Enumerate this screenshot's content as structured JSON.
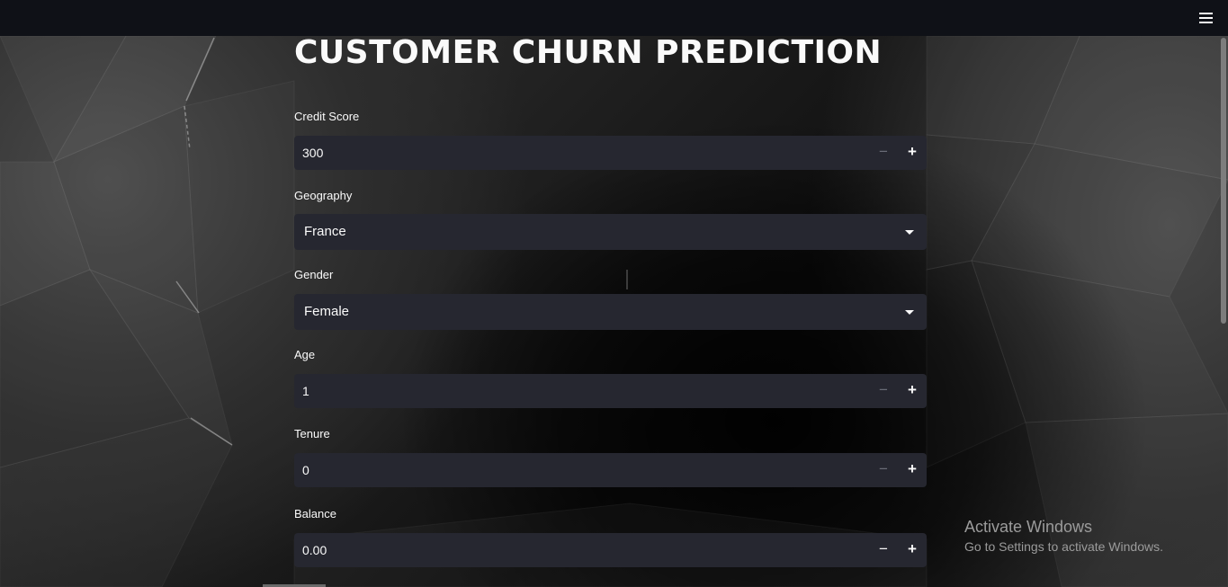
{
  "app": {
    "title": "CUSTOMER CHURN PREDICTION",
    "menu_icon": "hamburger-menu-icon"
  },
  "fields": {
    "credit_score": {
      "label": "Credit Score",
      "value": "300"
    },
    "geography": {
      "label": "Geography",
      "value": "France"
    },
    "gender": {
      "label": "Gender",
      "value": "Female"
    },
    "age": {
      "label": "Age",
      "value": "1"
    },
    "tenure": {
      "label": "Tenure",
      "value": "0"
    },
    "balance": {
      "label": "Balance",
      "value": "0.00"
    }
  },
  "stepper": {
    "minus": "−",
    "plus": "+"
  },
  "watermark": {
    "line1": "Activate Windows",
    "line2": "Go to Settings to activate Windows."
  },
  "colors": {
    "topbar": "#0f1117",
    "input_bg": "#262730",
    "text": "#fafafa"
  }
}
